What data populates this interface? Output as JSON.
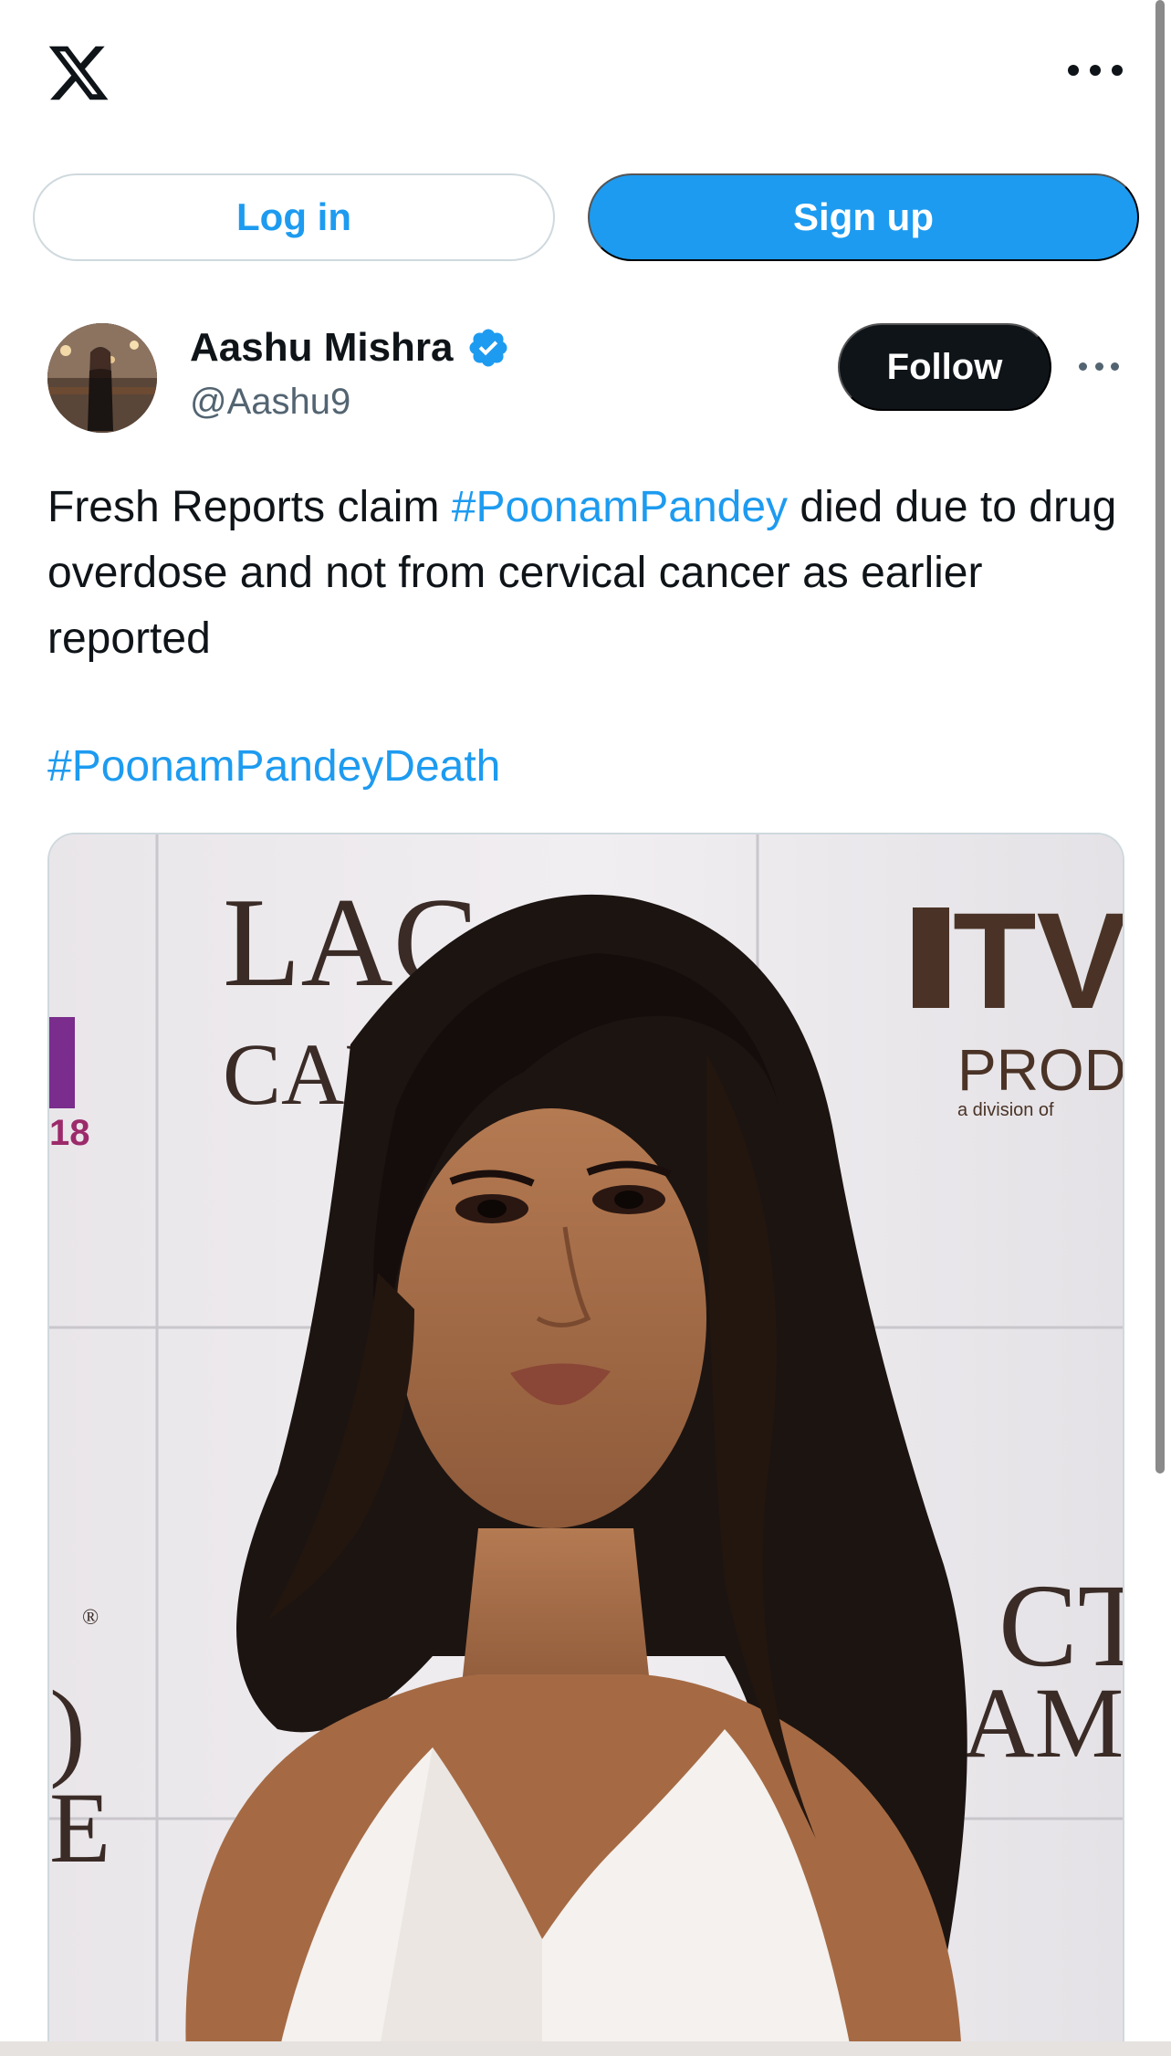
{
  "header": {
    "logo_icon": "x-logo-icon",
    "more_icon": "more-horizontal-icon"
  },
  "auth": {
    "login_label": "Log in",
    "signup_label": "Sign up"
  },
  "post": {
    "author": {
      "name": "Aashu Mishra",
      "handle": "@Aashu9",
      "verified_icon": "verified-badge-icon"
    },
    "follow_label": "Follow",
    "text": {
      "part1": "Fresh Reports claim ",
      "hashtag1": "#PoonamPandey",
      "part2": " died due to drug overdose and not from cervical cancer as earlier reported",
      "hashtag2": "#PoonamPandeyDeath"
    },
    "media": {
      "backdrop_text_left": "LAC",
      "backdrop_text_left2": "CAL",
      "backdrop_text_right": "TV",
      "backdrop_text_right2": "PRODUCT",
      "backdrop_text_right3": "a division of",
      "backdrop_text_left3": "18",
      "backdrop_text_left4": "E",
      "backdrop_text_right4": "CT",
      "backdrop_text_right5": "AM"
    }
  },
  "colors": {
    "accent": "#1d9bf0",
    "text_primary": "#0f1419",
    "text_secondary": "#536471",
    "border": "#cfd9de"
  }
}
